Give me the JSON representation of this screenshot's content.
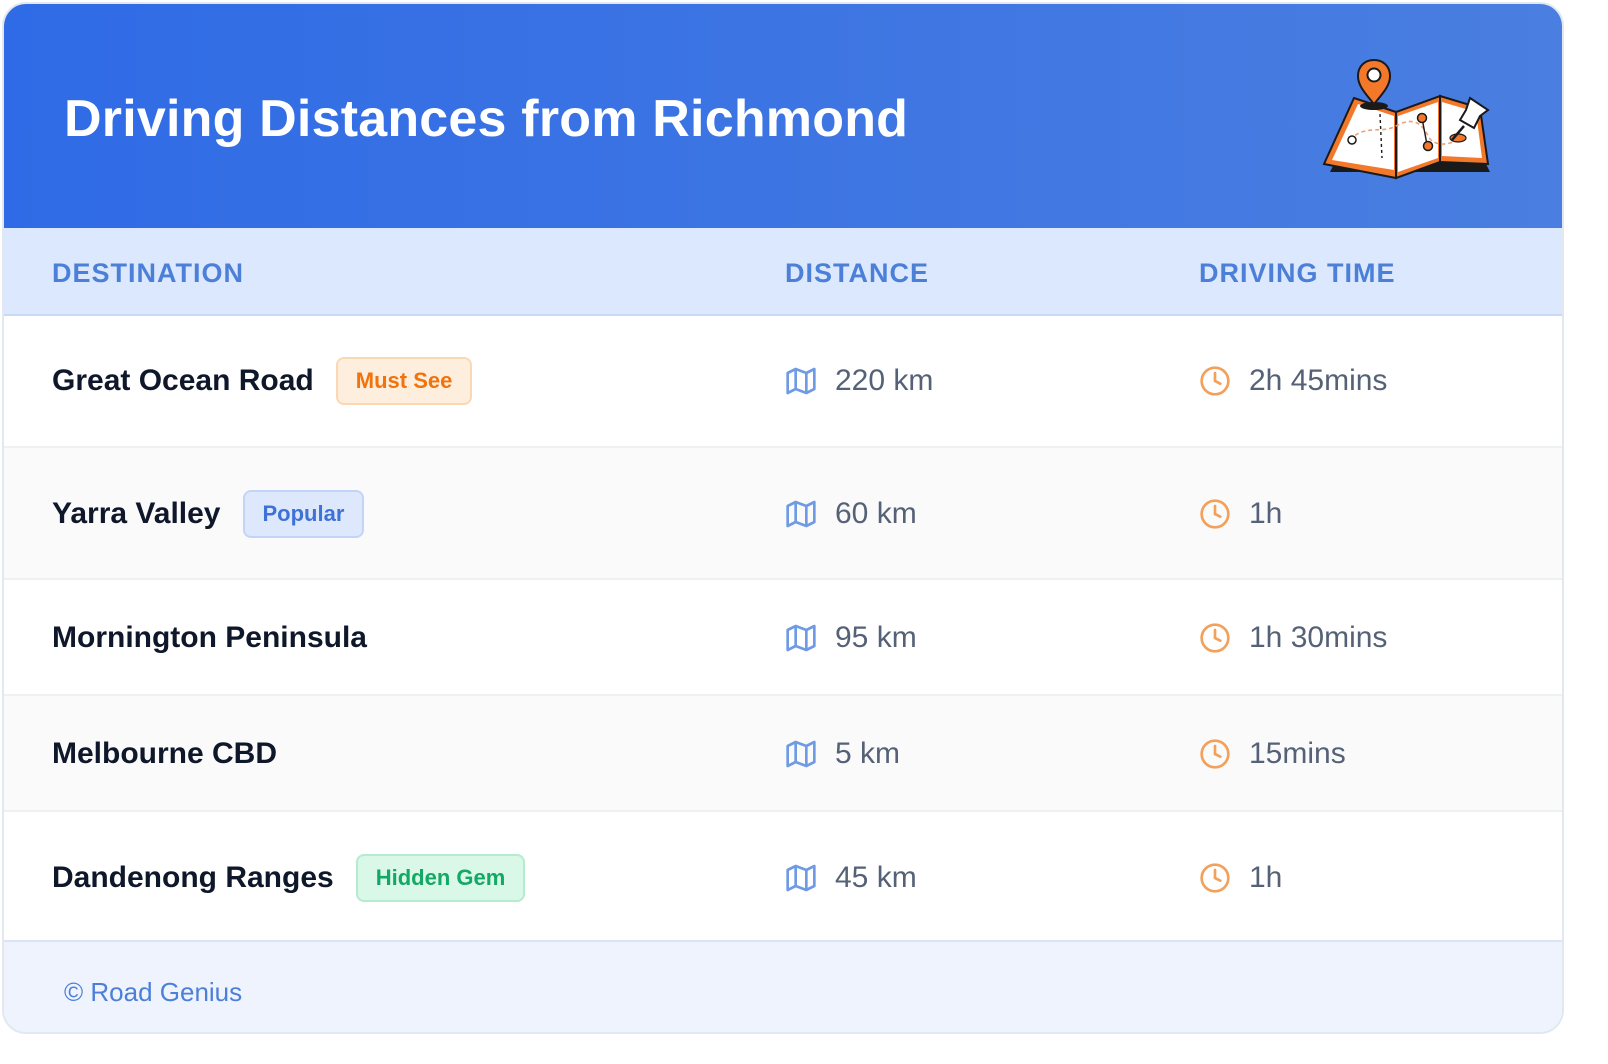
{
  "header": {
    "title": "Driving Distances from Richmond",
    "illustration": "map-with-pins-icon"
  },
  "columns": {
    "destination": "DESTINATION",
    "distance": "DISTANCE",
    "driving_time": "DRIVING TIME"
  },
  "rows": [
    {
      "destination": "Great Ocean Road",
      "badge": "Must See",
      "badge_color": "#f2720c",
      "distance": "220 km",
      "time": "2h 45mins"
    },
    {
      "destination": "Yarra Valley",
      "badge": "Popular",
      "badge_color": "#3f72d6",
      "distance": "60 km",
      "time": "1h"
    },
    {
      "destination": "Mornington Peninsula",
      "badge": "",
      "distance": "95 km",
      "time": "1h 30mins"
    },
    {
      "destination": "Melbourne CBD",
      "badge": "",
      "distance": "5 km",
      "time": "15mins"
    },
    {
      "destination": "Dandenong Ranges",
      "badge": "Hidden Gem",
      "badge_color": "#14a866",
      "distance": "45 km",
      "time": "1h"
    }
  ],
  "icons": {
    "distance": "map-icon",
    "time": "clock-icon"
  },
  "colors": {
    "header_start": "#2f6be6",
    "header_end": "#4a7ee0",
    "accent": "#4b7fd8",
    "clock": "#f2a05a",
    "map": "#6e9be3"
  },
  "footer": {
    "text": "© Road Genius"
  }
}
